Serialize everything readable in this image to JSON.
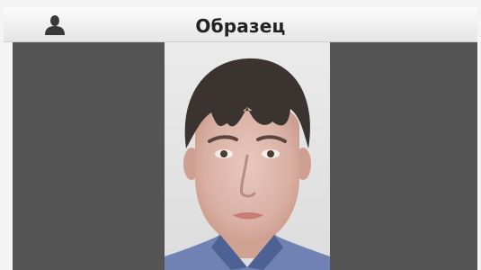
{
  "header": {
    "title": "Образец",
    "icon": "user-silhouette-icon"
  },
  "colors": {
    "viewer_background": "#555555",
    "header_gradient_top": "#fbfbfb",
    "header_gradient_bottom": "#e6e6e6"
  }
}
